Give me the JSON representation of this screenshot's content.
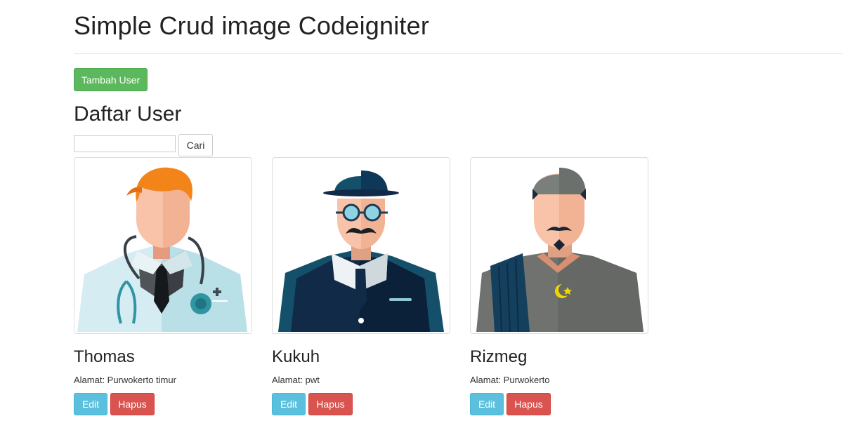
{
  "header": {
    "title": "Simple Crud image Codeigniter"
  },
  "toolbar": {
    "add_user_label": "Tambah User"
  },
  "section": {
    "title": "Daftar User"
  },
  "search": {
    "value": "",
    "placeholder": "",
    "button_label": "Cari"
  },
  "users": [
    {
      "name": "Thomas",
      "address": "Alamat: Purwokerto timur",
      "avatar_icon": "doctor-avatar-icon",
      "edit_label": "Edit",
      "delete_label": "Hapus"
    },
    {
      "name": "Kukuh",
      "address": "Alamat: pwt",
      "avatar_icon": "gentleman-avatar-icon",
      "edit_label": "Edit",
      "delete_label": "Hapus"
    },
    {
      "name": "Rizmeg",
      "address": "Alamat: Purwokerto",
      "avatar_icon": "muslim-man-avatar-icon",
      "edit_label": "Edit",
      "delete_label": "Hapus"
    }
  ],
  "colors": {
    "success": "#5cb85c",
    "info": "#5bc0de",
    "danger": "#d9534f"
  }
}
